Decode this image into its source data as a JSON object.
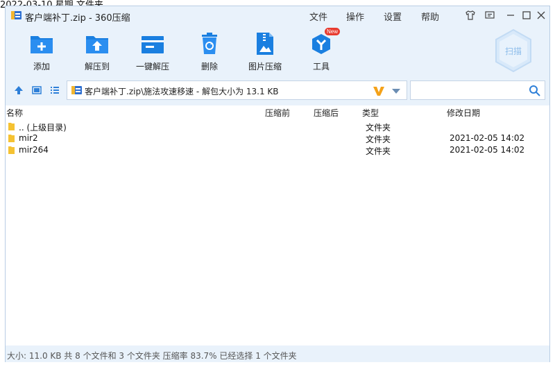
{
  "background_text": "2022-03-10 星期    文件夹",
  "window": {
    "title": "客户端补丁.zip - 360压缩",
    "menu": [
      "文件",
      "操作",
      "设置",
      "帮助"
    ]
  },
  "toolbar": {
    "add": "添加",
    "extract_to": "解压到",
    "one_click_extract": "一键解压",
    "delete": "删除",
    "image_compress": "图片压缩",
    "tools": "工具",
    "tools_badge": "New",
    "scan": "扫描"
  },
  "address": {
    "path": "客户端补丁.zip\\施法攻速移速 - 解包大小为 13.1 KB"
  },
  "search": {
    "placeholder": "",
    "value": ""
  },
  "columns": {
    "name": "名称",
    "compressed": "压缩前",
    "packed": "压缩后",
    "type": "类型",
    "modified": "修改日期"
  },
  "rows": [
    {
      "name": ".. (上级目录)",
      "type": "文件夹",
      "modified": ""
    },
    {
      "name": "mir2",
      "type": "文件夹",
      "modified": "2021-02-05 14:02"
    },
    {
      "name": "mir264",
      "type": "文件夹",
      "modified": "2021-02-05 14:02"
    }
  ],
  "status": {
    "text": "大小: 11.0 KB 共 8 个文件和 3 个文件夹 压缩率 83.7% 已经选择 1 个文件夹"
  },
  "colors": {
    "accent_blue": "#1a7fe0",
    "window_bg": "#e9f2fb",
    "folder_yellow": "#f5c232",
    "badge_red": "#e83b2f",
    "v_orange": "#f4a21a"
  }
}
